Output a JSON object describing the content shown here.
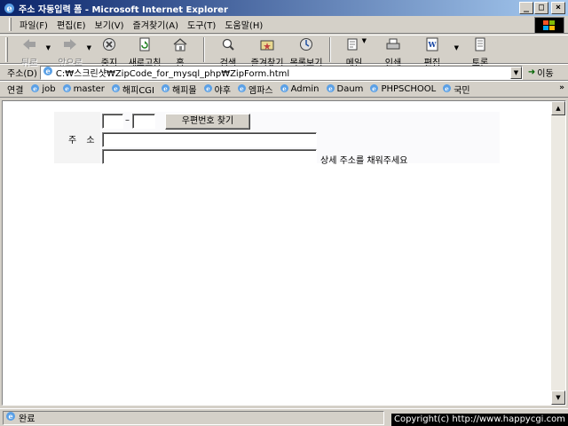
{
  "window": {
    "title": "주소 자동입력 폼 - Microsoft Internet Explorer",
    "minimize": "_",
    "maximize": "□",
    "close": "×"
  },
  "menu": {
    "items": [
      "파일(F)",
      "편집(E)",
      "보기(V)",
      "즐겨찾기(A)",
      "도구(T)",
      "도움말(H)"
    ]
  },
  "toolbar": {
    "back": "뒤로",
    "forward": "앞으로",
    "stop": "중지",
    "refresh": "새로고침",
    "home": "홈",
    "search": "검색",
    "favorites": "즐겨찾기",
    "history": "목록보기",
    "mail": "메일",
    "print": "인쇄",
    "edit": "편집",
    "discuss": "토론"
  },
  "address": {
    "label": "주소(D)",
    "url": "C:₩스크린샷₩ZipCode_for_mysql_php₩ZipForm.html",
    "go": "이동"
  },
  "links": {
    "label": "연결",
    "items": [
      "job",
      "master",
      "해피CGI",
      "해피몰",
      "야후",
      "엠파스",
      "Admin",
      "Daum",
      "PHPSCHOOL",
      "국민"
    ],
    "more": "»"
  },
  "form": {
    "label": "주 소",
    "zip1": "",
    "zip2": "",
    "zip_separator": "–",
    "find_button": "우편번호 찾기",
    "address1": "",
    "address2": "",
    "hint": "상세 주소를 채워주세요"
  },
  "status": {
    "text": "완료"
  },
  "watermark": {
    "text": "Copyright(c) http://www.happycgi.com"
  }
}
